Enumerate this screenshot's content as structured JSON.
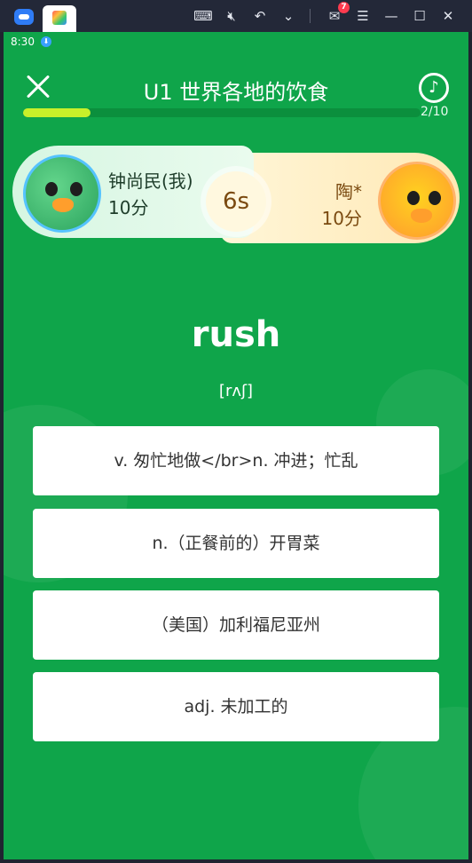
{
  "titlebar": {
    "icons": [
      "app-logo-icon",
      "keyboard-icon",
      "mute-icon",
      "undo-icon",
      "chevron-down-icon",
      "mail-icon",
      "menu-icon",
      "minimize-icon",
      "maximize-icon",
      "close-window-icon"
    ],
    "mail_badge": "7"
  },
  "status": {
    "time": "8:30",
    "download_glyph": "⬇"
  },
  "header": {
    "title": "U1 世界各地的饮食",
    "progress_text": "2/10",
    "progress_fraction": 0.17
  },
  "players": {
    "me": {
      "name": "钟尚民(我)",
      "score": "10分"
    },
    "opponent": {
      "name": "陶*",
      "score": "10分"
    },
    "timer": "6s"
  },
  "question": {
    "word": "rush",
    "phonetic": "[rʌʃ]"
  },
  "options": [
    "v. 匆忙地做</br>n. 冲进；忙乱",
    "n.（正餐前的）开胃菜",
    "（美国）加利福尼亚州",
    "adj. 未加工的"
  ],
  "colors": {
    "background": "#0fa54a",
    "progress_fill": "#c8f02a",
    "option_bg": "#ffffff",
    "option_text": "#333333"
  }
}
